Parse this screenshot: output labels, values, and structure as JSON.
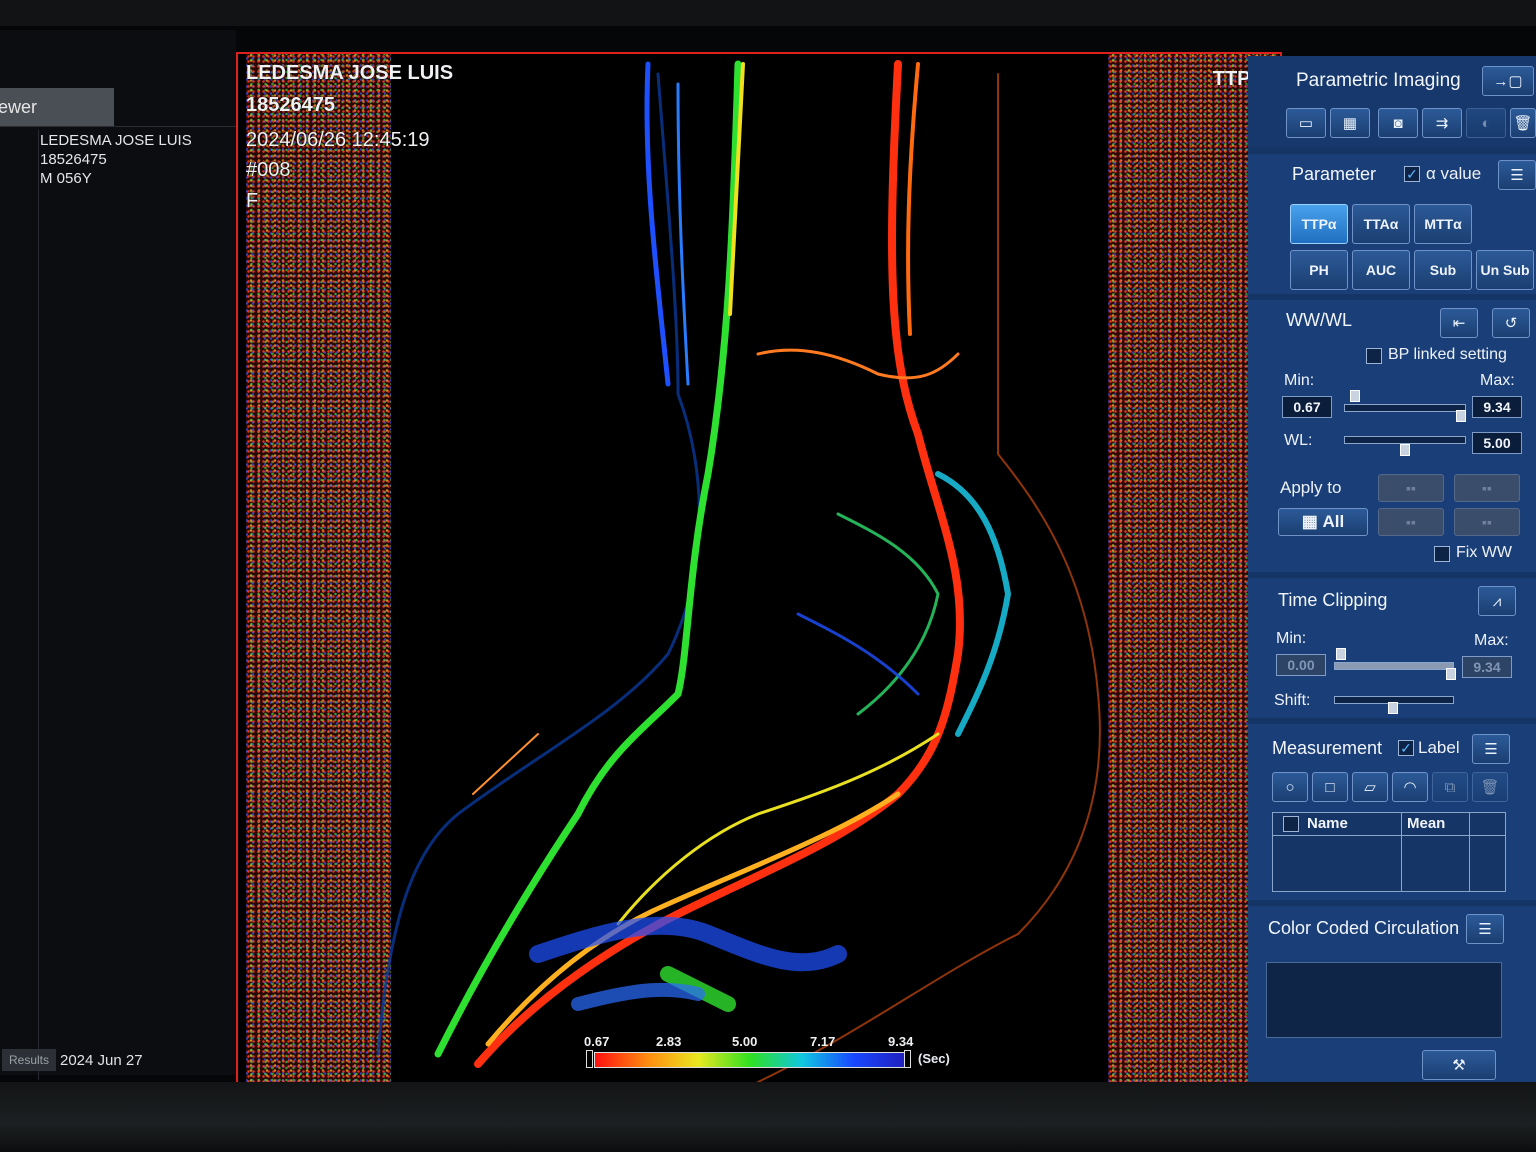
{
  "left": {
    "viewer_tab": "ewer",
    "patient_name": "LEDESMA JOSE LUIS",
    "patient_id": "18526475",
    "patient_sex_age": "M 056Y",
    "results_tab": "Results",
    "results_date": "2024 Jun 27"
  },
  "image": {
    "name": "LEDESMA JOSE LUIS",
    "id": "18526475",
    "datetime": "2024/06/26 12:45:19",
    "series": "#008",
    "orientation": "F",
    "mode": "TTP α",
    "colorbar": {
      "ticks": [
        "0.67",
        "2.83",
        "5.00",
        "7.17",
        "9.34"
      ],
      "unit": "(Sec)"
    }
  },
  "panel": {
    "title": "Parametric Imaging",
    "parameter": {
      "label": "Parameter",
      "alpha_label": "α value",
      "alpha_checked": true,
      "buttons_row1": [
        "TTPα",
        "TTAα",
        "MTTα"
      ],
      "buttons_row2": [
        "PH",
        "AUC",
        "Sub",
        "Un Sub"
      ],
      "active": "TTPα"
    },
    "wwwl": {
      "label": "WW/WL",
      "bp_linked": "BP linked setting",
      "min_label": "Min:",
      "max_label": "Max:",
      "min": "0.67",
      "max": "9.34",
      "wl_label": "WL:",
      "wl": "5.00",
      "apply_to": "Apply to",
      "all": "All",
      "fix_ww": "Fix WW"
    },
    "time_clipping": {
      "label": "Time Clipping",
      "min_label": "Min:",
      "max_label": "Max:",
      "min": "0.00",
      "max": "9.34",
      "shift_label": "Shift:"
    },
    "measurement": {
      "label": "Measurement",
      "label_check": "Label",
      "label_checked": true,
      "col_name": "Name",
      "col_mean": "Mean"
    },
    "color_coded": {
      "label": "Color Coded Circulation"
    }
  },
  "colors": {
    "viewport_border": "#e0201c",
    "panel_bg": "#163567",
    "active_button": "#3a92e0"
  }
}
